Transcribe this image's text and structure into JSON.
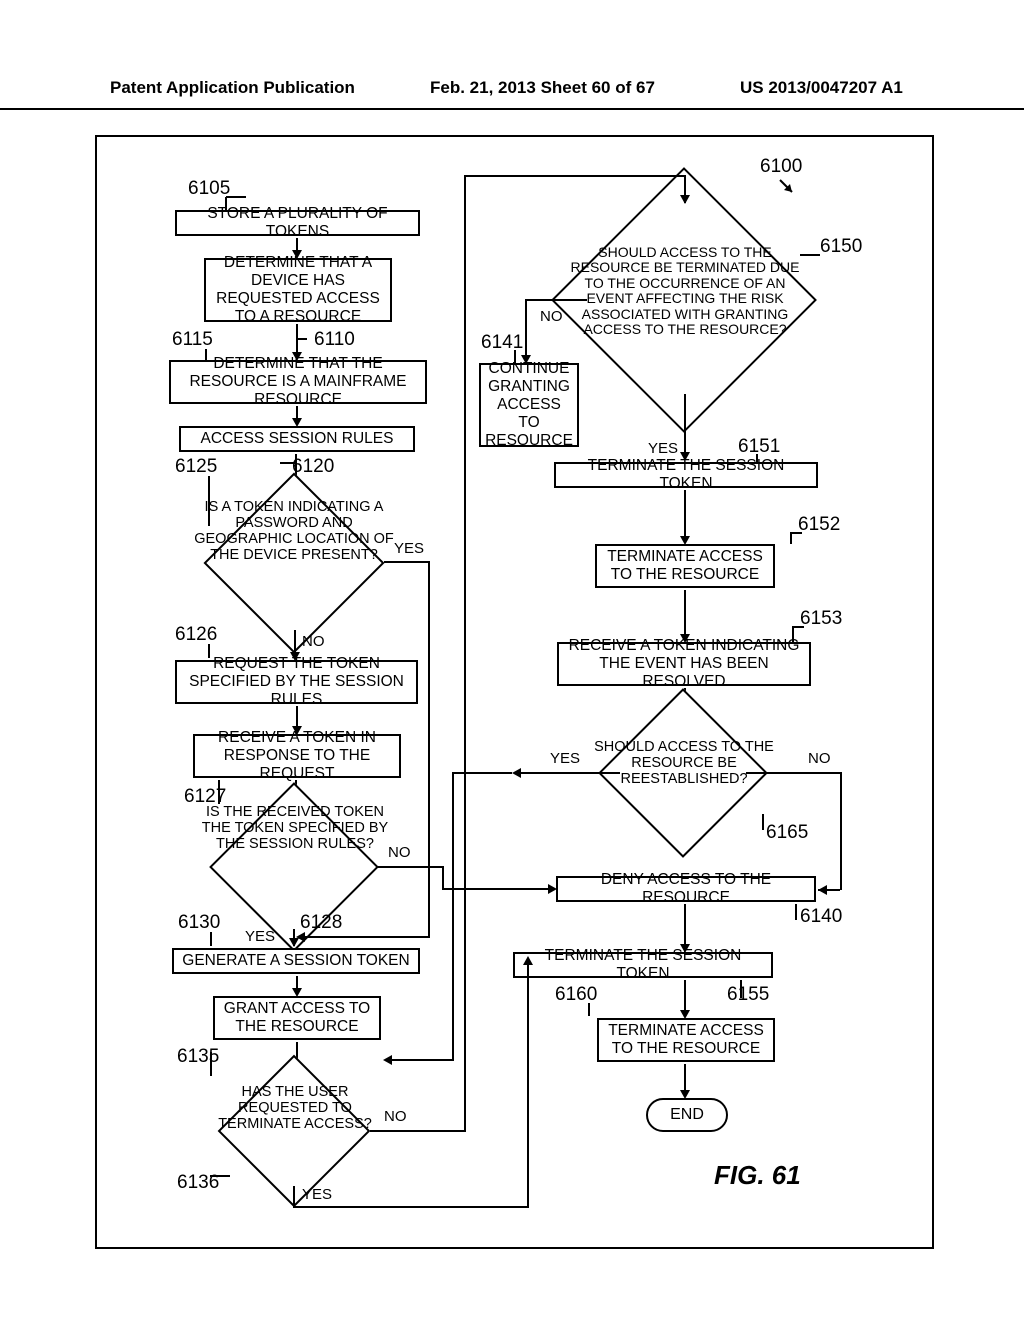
{
  "header": {
    "left": "Patent Application Publication",
    "center": "Feb. 21, 2013  Sheet 60 of 67",
    "right": "US 2013/0047207 A1"
  },
  "refs": {
    "r6100": "6100",
    "r6105": "6105",
    "r6110": "6110",
    "r6115": "6115",
    "r6120": "6120",
    "r6125": "6125",
    "r6126": "6126",
    "r6127": "6127",
    "r6128": "6128",
    "r6130": "6130",
    "r6135": "6135",
    "r6136": "6136",
    "r6140": "6140",
    "r6141": "6141",
    "r6150": "6150",
    "r6151": "6151",
    "r6152": "6152",
    "r6153": "6153",
    "r6155": "6155",
    "r6160": "6160",
    "r6165": "6165"
  },
  "boxes": {
    "b6105": "STORE A PLURALITY OF TOKENS",
    "b6110": "DETERMINE THAT A DEVICE HAS REQUESTED ACCESS TO A RESOURCE",
    "b6115": "DETERMINE THAT THE RESOURCE IS A MAINFRAME RESOURCE",
    "b6120": "ACCESS SESSION RULES",
    "b6126": "REQUEST THE TOKEN SPECIFIED BY THE SESSION RULES",
    "b6127": "RECEIVE A TOKEN IN RESPONSE TO THE REQUEST",
    "b6130": "GENERATE A SESSION TOKEN",
    "b6135": "GRANT ACCESS TO THE RESOURCE",
    "b6141": "CONTINUE GRANTING ACCESS TO RESOURCE",
    "b6151": "TERMINATE THE SESSION TOKEN",
    "b6152": "TERMINATE ACCESS TO THE RESOURCE",
    "b6153": "RECEIVE A TOKEN INDICATING THE EVENT HAS BEEN RESOLVED",
    "b6140": "DENY ACCESS TO THE RESOURCE",
    "b6155": "TERMINATE THE SESSION TOKEN",
    "b6160": "TERMINATE ACCESS TO THE RESOURCE",
    "bend": "END"
  },
  "diamonds": {
    "d6125": "IS A TOKEN INDICATING A PASSWORD AND GEOGRAPHIC LOCATION OF THE DEVICE PRESENT?",
    "d6128": "IS THE RECEIVED TOKEN THE TOKEN SPECIFIED BY THE SESSION RULES?",
    "d6136": "HAS THE USER REQUESTED TO TERMINATE ACCESS?",
    "d6150": "SHOULD ACCESS TO THE RESOURCE BE TERMINATED DUE TO THE OCCURRENCE OF AN EVENT AFFECTING THE RISK ASSOCIATED WITH GRANTING ACCESS TO THE RESOURCE?",
    "d6165": "SHOULD ACCESS TO THE RESOURCE BE REESTABLISHED?"
  },
  "yn": {
    "yes": "YES",
    "no": "NO"
  },
  "fig": "FIG. 61"
}
